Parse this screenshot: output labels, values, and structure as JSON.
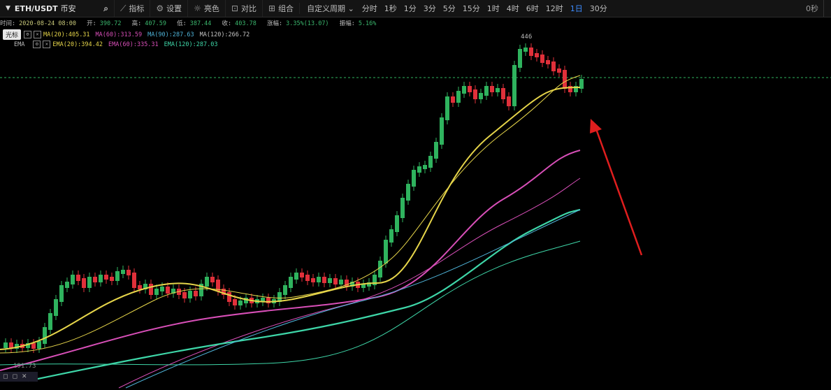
{
  "toolbar": {
    "symbol": "ETH/USDT",
    "market": "币安",
    "buttons": [
      {
        "icon": "indicator-icon",
        "glyph": "⟋",
        "label": "指标"
      },
      {
        "icon": "gear-icon",
        "glyph": "⚙",
        "label": "设置"
      },
      {
        "icon": "sun-icon",
        "glyph": "☼",
        "label": "亮色"
      },
      {
        "icon": "compare-icon",
        "glyph": "⊡",
        "label": "对比"
      },
      {
        "icon": "combo-icon",
        "glyph": "⊞",
        "label": "组合"
      }
    ],
    "custom_period": "自定义周期",
    "periods": [
      "分时",
      "1秒",
      "1分",
      "3分",
      "5分",
      "15分",
      "1时",
      "4时",
      "6时",
      "12时",
      "1日",
      "30分"
    ],
    "active_period": "1日",
    "countdown": "0秒"
  },
  "info_line": {
    "time_label": "时间:",
    "time_value": "2020-08-24 08:00",
    "open_label": "开:",
    "open_value": "390.72",
    "high_label": "高:",
    "high_value": "407.59",
    "low_label": "低:",
    "low_value": "387.44",
    "close_label": "收:",
    "close_value": "403.78",
    "change_label": "涨幅:",
    "change_value": "3.35%(13.07)",
    "amp_label": "振幅:",
    "amp_value": "5.16%"
  },
  "ma_line": {
    "chip": "光标",
    "ma20": "MA(20):405.31",
    "ma60": "MA(60):313.59",
    "ma90": "MA(90):287.63",
    "ma120": "MA(120):266.72"
  },
  "ema_line": {
    "label": "EMA",
    "ema20": "EMA(20):394.42",
    "ema60": "EMA(60):335.31",
    "ema120": "EMA(120):287.03"
  },
  "chart_labels": {
    "max": "446",
    "min": "191.73"
  },
  "colors": {
    "up": "#2fb35e",
    "down": "#e0303a",
    "ma20": "#e6d54a",
    "ma60": "#d84fb8",
    "ma120": "#3ed6a8",
    "ma90": "#4fb3d8",
    "arrow": "#e01e1e",
    "price_line": "#2fb35e"
  }
}
